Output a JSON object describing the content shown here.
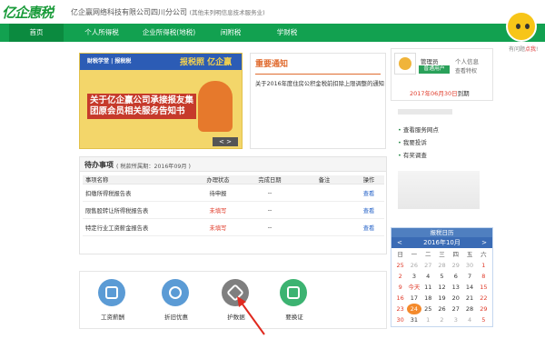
{
  "header": {
    "logo": "亿企惠税",
    "company": "亿企赢网络科技有限公司四川分公司",
    "company_sub": "(其他未列明信息技术服务业)",
    "top_right": "○"
  },
  "nav": {
    "items": [
      "首页",
      "个人所得税",
      "企业所得税(地税)",
      "间附税",
      "学财税"
    ]
  },
  "mascot": {
    "label_a": "有问题",
    "label_b": "点我",
    "label_c": "!"
  },
  "banner": {
    "top_left": "财税学堂 | 报税税",
    "top_right": "报税照 亿企赢",
    "headline": "关于亿企赢公司承接报友集团原会员相关服务告知书",
    "controls": "< >"
  },
  "notice": {
    "title": "重要通知",
    "items": [
      "关于2016年度住房公积金税前扣除上限调整的通知"
    ]
  },
  "user": {
    "role": "管理员",
    "badge": "普通用户",
    "link1": "个人信息",
    "link2": "查看特权",
    "date_prefix": "2017年06月30日",
    "date_suffix": "到期"
  },
  "right_links": [
    "查看服务网点",
    "我要投诉",
    "有奖调查"
  ],
  "todo": {
    "title": "待办事项",
    "period": "( 税款所属期：2016年09月 )",
    "columns": [
      "事项名称",
      "办理状态",
      "完成日期",
      "备注",
      "操作"
    ],
    "rows": [
      {
        "name": "扣缴所得税报告表",
        "status": "待申报",
        "date": "--",
        "note": "",
        "action": "查看",
        "status_red": false
      },
      {
        "name": "限售股转让所得税报告表",
        "status": "未填写",
        "date": "--",
        "note": "",
        "action": "查看",
        "status_red": true
      },
      {
        "name": "特定行业工资薪金报告表",
        "status": "未填写",
        "date": "--",
        "note": "",
        "action": "查看",
        "status_red": true
      }
    ]
  },
  "shortcuts": [
    {
      "label": "工资薪酬",
      "icon": "payroll-icon",
      "color": "#5b9bd5"
    },
    {
      "label": "折旧优惠",
      "icon": "depreciation-icon",
      "color": "#5b9bd5"
    },
    {
      "label": "护数据",
      "icon": "data-layers-icon",
      "color": "#7f7f7f"
    },
    {
      "label": "要换证",
      "icon": "certificate-icon",
      "color": "#3cb371"
    }
  ],
  "calendar": {
    "title": "报税日历",
    "month": "2016年10月",
    "weekdays": [
      "日",
      "一",
      "二",
      "三",
      "四",
      "五",
      "六"
    ],
    "days": [
      [
        "25",
        "26",
        "27",
        "28",
        "29",
        "30",
        "1"
      ],
      [
        "2",
        "3",
        "4",
        "5",
        "6",
        "7",
        "8"
      ],
      [
        "9",
        "今天",
        "11",
        "12",
        "13",
        "14",
        "15"
      ],
      [
        "16",
        "17",
        "18",
        "19",
        "20",
        "21",
        "22"
      ],
      [
        "23",
        "24",
        "25",
        "26",
        "27",
        "28",
        "29"
      ],
      [
        "30",
        "31",
        "1",
        "2",
        "3",
        "4",
        "5"
      ]
    ]
  }
}
